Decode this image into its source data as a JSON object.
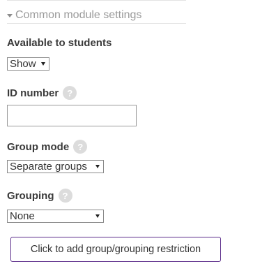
{
  "section": {
    "title": "Common module settings"
  },
  "fields": {
    "availability": {
      "label": "Available to students",
      "value": "Show"
    },
    "id_number": {
      "label": "ID number",
      "value": ""
    },
    "group_mode": {
      "label": "Group mode",
      "value": "Separate groups"
    },
    "grouping": {
      "label": "Grouping",
      "value": "None"
    }
  },
  "help_icon": "?",
  "restriction_button": {
    "label": "Click to add group/grouping restriction"
  },
  "colors": {
    "button_border": "#5b2c8a",
    "help_icon_bg": "#dcdcdc",
    "section_title": "#9a9a9a"
  },
  "icons": {
    "section_toggle": "caret-down-icon",
    "help": "help-icon",
    "dropdown": "dropdown-arrow-icon"
  }
}
